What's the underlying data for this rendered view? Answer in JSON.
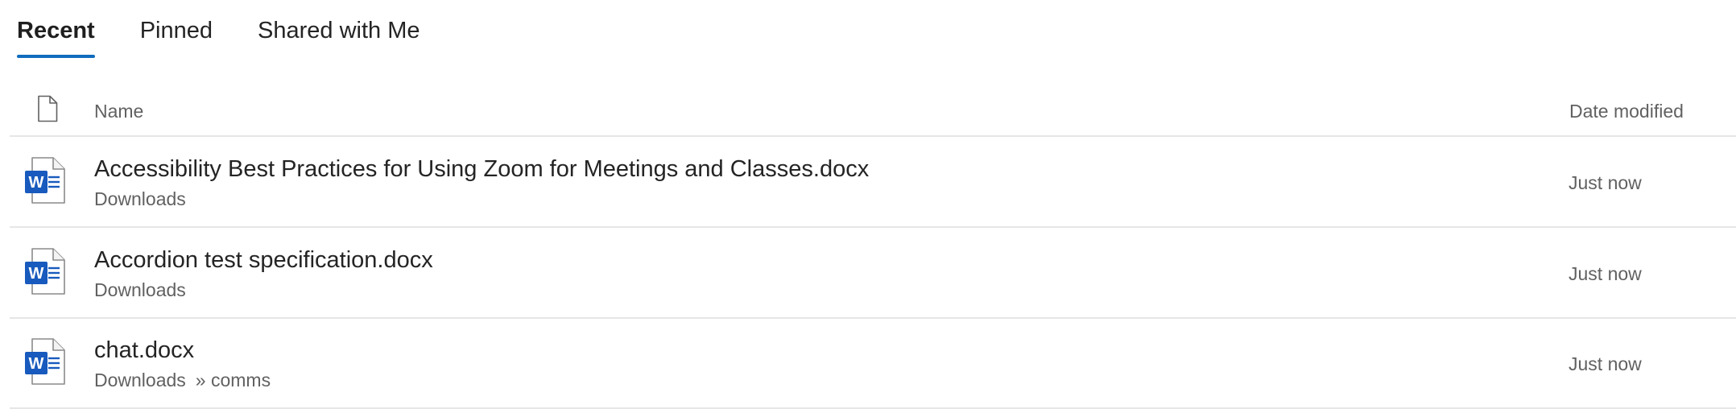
{
  "tabs": [
    {
      "label": "Recent",
      "active": true
    },
    {
      "label": "Pinned",
      "active": false
    },
    {
      "label": "Shared with Me",
      "active": false
    }
  ],
  "header": {
    "file_type_icon": "document-icon",
    "name_label": "Name",
    "date_label": "Date modified"
  },
  "files": [
    {
      "icon": "word-document-icon",
      "name": "Accessibility Best Practices for Using Zoom for Meetings and Classes.docx",
      "location": "Downloads",
      "sublocation": "",
      "modified": "Just now"
    },
    {
      "icon": "word-document-icon",
      "name": "Accordion test specification.docx",
      "location": "Downloads",
      "sublocation": "",
      "modified": "Just now"
    },
    {
      "icon": "word-document-icon",
      "name": "chat.docx",
      "location": "Downloads",
      "sublocation": "» comms",
      "modified": "Just now"
    }
  ],
  "colors": {
    "accent": "#0f6cbd",
    "word_blue": "#185abd",
    "divider": "#e6e6e6",
    "secondary_text": "#616161"
  }
}
